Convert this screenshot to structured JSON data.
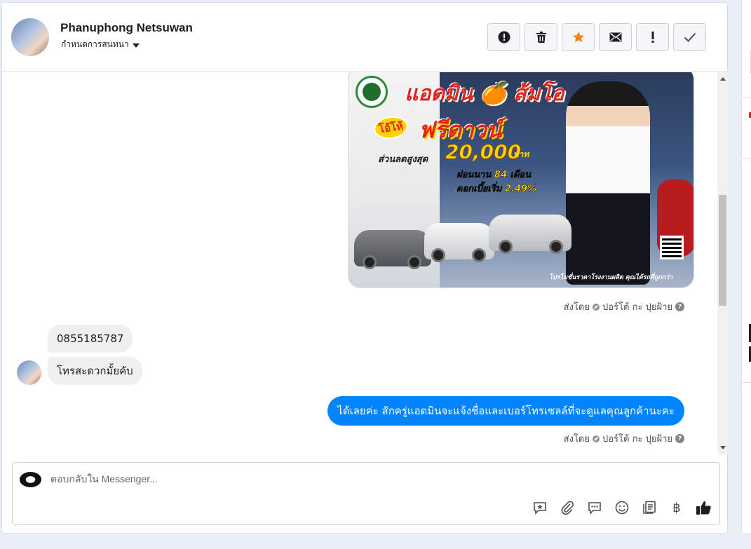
{
  "header": {
    "user_name": "Phanuphong Netsuwan",
    "settings_label": "กำหนดการสนทนา",
    "actions": [
      {
        "id": "report",
        "icon": "alert-circle-icon"
      },
      {
        "id": "delete",
        "icon": "trash-icon"
      },
      {
        "id": "star",
        "icon": "star-icon",
        "color": "#f5821f"
      },
      {
        "id": "mail",
        "icon": "envelope-icon"
      },
      {
        "id": "spam",
        "icon": "exclamation-icon"
      },
      {
        "id": "done",
        "icon": "checkmark-icon"
      }
    ]
  },
  "ad_image": {
    "line1": "แอดมิน 🍊 ส้มโอ",
    "line2": "โอ้โห้",
    "line3": "ฟรีดาวน์",
    "line4": "ส่วนลดสูงสุด",
    "line5": "20,000",
    "line6": "บาท",
    "line7": "ผ่อนนาน 84 เดือน",
    "line8": "ดอกเบี้ยเริ่ม 2.49%",
    "line9": "โปรโมชั่นราคาโรงงานผลิต คุณได้รถที่ถูกกว่า"
  },
  "messages": {
    "sent_by_1": "ส่งโดย",
    "sender_1": "ปอร์โต้ กะ ปุยฝ้าย",
    "incoming": [
      "0855185787",
      "โทรสะดวกมั้ยคับ"
    ],
    "outgoing": "ได้เลยค่ะ สักครู่แอดมินจะแจ้งชื่อและเบอร์โทรเซลล์ที่จะดูแลคุณลูกค้านะคะ",
    "sent_by_2": "ส่งโดย",
    "sender_2": "ปอร์โต้ กะ ปุยฝ้าย"
  },
  "composer": {
    "placeholder": "ตอบกลับใน Messenger...",
    "tools": [
      "saved-reply-icon",
      "attachment-icon",
      "chat-bubble-icon",
      "emoji-icon",
      "notes-icon",
      "baht-icon",
      "like-icon"
    ],
    "baht_symbol": "฿"
  },
  "colors": {
    "accent": "#0084ff",
    "star": "#f5821f",
    "panel_bg": "#e9eef8"
  }
}
